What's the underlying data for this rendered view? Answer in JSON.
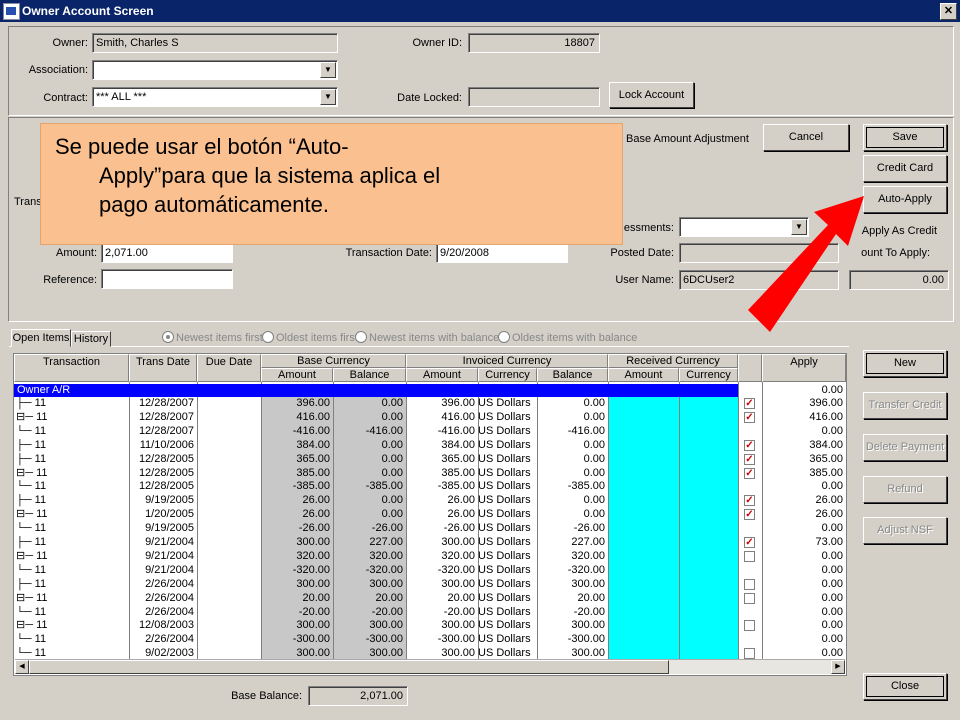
{
  "window": {
    "title": "Owner Account Screen",
    "close_glyph": "✕"
  },
  "owner": {
    "owner_label": "Owner:",
    "owner_value": "Smith, Charles S",
    "owner_id_label": "Owner ID:",
    "owner_id_value": "18807",
    "association_label": "Association:",
    "association_value": "",
    "contract_label": "Contract:",
    "contract_value": "*** ALL ***",
    "date_locked_label": "Date Locked:",
    "date_locked_value": "",
    "lock_button": "Lock Account"
  },
  "transaction": {
    "trans_label_partial": "Trans",
    "base_amount_adjustment": "Base Amount Adjustment",
    "amount_label": "Amount:",
    "amount_value": "2,071.00",
    "reference_label": "Reference:",
    "reference_value": "",
    "transaction_date_label": "Transaction Date:",
    "transaction_date_value": "9/20/2008",
    "assessments_label": "essments:",
    "assessments_value": "",
    "posted_date_label": "Posted Date:",
    "posted_date_value": "",
    "user_name_label": "User Name:",
    "user_name_value": "6DCUser2",
    "apply_as_credit_label": "Apply As Credit",
    "amount_to_apply_label": "ount To Apply:",
    "amount_to_apply_value": "0.00"
  },
  "buttons": {
    "cancel": "Cancel",
    "save": "Save",
    "credit_card": "Credit Card",
    "auto_apply": "Auto-Apply",
    "new": "New",
    "transfer_credit": "Transfer Credit",
    "delete_payment": "Delete Payment",
    "refund": "Refund",
    "adjust_nsf": "Adjust NSF",
    "close": "Close"
  },
  "callout": {
    "line1": "Se puede usar el botón “Auto-",
    "line2": "Apply”para que la sistema aplica el",
    "line3": "pago automáticamente."
  },
  "tabs": {
    "open_items": "Open Items",
    "history": "History"
  },
  "filters": [
    {
      "label": "Newest items first",
      "selected": true
    },
    {
      "label": "Oldest items first",
      "selected": false
    },
    {
      "label": "Newest items with balance",
      "selected": false
    },
    {
      "label": "Oldest items with balance",
      "selected": false
    }
  ],
  "grid": {
    "headers": {
      "transaction": "Transaction",
      "trans_date": "Trans Date",
      "due_date": "Due Date",
      "base_currency": "Base Currency",
      "invoiced_currency": "Invoiced Currency",
      "received_currency": "Received Currency",
      "apply": "Apply",
      "amount": "Amount",
      "balance": "Balance",
      "currency": "Currency"
    },
    "owner_row": {
      "label": "Owner A/R",
      "apply": "0.00"
    },
    "rows": [
      {
        "prefix": "├─",
        "trans": "11",
        "date": "12/28/2007",
        "base_amt": "396.00",
        "base_bal": "0.00",
        "inv_amt": "396.00",
        "cur": "US Dollars",
        "inv_bal": "0.00",
        "check": "checked",
        "apply": "396.00"
      },
      {
        "prefix": "⊟─",
        "trans": "11",
        "date": "12/28/2007",
        "base_amt": "416.00",
        "base_bal": "0.00",
        "inv_amt": "416.00",
        "cur": "US Dollars",
        "inv_bal": "0.00",
        "check": "checked",
        "apply": "416.00"
      },
      {
        "prefix": "   └─",
        "trans": "11",
        "date": "12/28/2007",
        "base_amt": "-416.00",
        "base_bal": "-416.00",
        "inv_amt": "-416.00",
        "cur": "US Dollars",
        "inv_bal": "-416.00",
        "check": "none",
        "apply": "0.00"
      },
      {
        "prefix": "├─",
        "trans": "11",
        "date": "11/10/2006",
        "base_amt": "384.00",
        "base_bal": "0.00",
        "inv_amt": "384.00",
        "cur": "US Dollars",
        "inv_bal": "0.00",
        "check": "checked",
        "apply": "384.00"
      },
      {
        "prefix": "├─",
        "trans": "11",
        "date": "12/28/2005",
        "base_amt": "365.00",
        "base_bal": "0.00",
        "inv_amt": "365.00",
        "cur": "US Dollars",
        "inv_bal": "0.00",
        "check": "checked",
        "apply": "365.00"
      },
      {
        "prefix": "⊟─",
        "trans": "11",
        "date": "12/28/2005",
        "base_amt": "385.00",
        "base_bal": "0.00",
        "inv_amt": "385.00",
        "cur": "US Dollars",
        "inv_bal": "0.00",
        "check": "checked",
        "apply": "385.00"
      },
      {
        "prefix": "   └─",
        "trans": "11",
        "date": "12/28/2005",
        "base_amt": "-385.00",
        "base_bal": "-385.00",
        "inv_amt": "-385.00",
        "cur": "US Dollars",
        "inv_bal": "-385.00",
        "check": "none",
        "apply": "0.00"
      },
      {
        "prefix": "├─",
        "trans": "11",
        "date": "9/19/2005",
        "base_amt": "26.00",
        "base_bal": "0.00",
        "inv_amt": "26.00",
        "cur": "US Dollars",
        "inv_bal": "0.00",
        "check": "checked",
        "apply": "26.00"
      },
      {
        "prefix": "⊟─",
        "trans": "11",
        "date": "1/20/2005",
        "base_amt": "26.00",
        "base_bal": "0.00",
        "inv_amt": "26.00",
        "cur": "US Dollars",
        "inv_bal": "0.00",
        "check": "checked",
        "apply": "26.00"
      },
      {
        "prefix": "   └─",
        "trans": "11",
        "date": "9/19/2005",
        "base_amt": "-26.00",
        "base_bal": "-26.00",
        "inv_amt": "-26.00",
        "cur": "US Dollars",
        "inv_bal": "-26.00",
        "check": "none",
        "apply": "0.00"
      },
      {
        "prefix": "├─",
        "trans": "11",
        "date": "9/21/2004",
        "base_amt": "300.00",
        "base_bal": "227.00",
        "inv_amt": "300.00",
        "cur": "US Dollars",
        "inv_bal": "227.00",
        "check": "checked",
        "apply": "73.00"
      },
      {
        "prefix": "⊟─",
        "trans": "11",
        "date": "9/21/2004",
        "base_amt": "320.00",
        "base_bal": "320.00",
        "inv_amt": "320.00",
        "cur": "US Dollars",
        "inv_bal": "320.00",
        "check": "empty",
        "apply": "0.00"
      },
      {
        "prefix": "   └─",
        "trans": "11",
        "date": "9/21/2004",
        "base_amt": "-320.00",
        "base_bal": "-320.00",
        "inv_amt": "-320.00",
        "cur": "US Dollars",
        "inv_bal": "-320.00",
        "check": "none",
        "apply": "0.00"
      },
      {
        "prefix": "├─",
        "trans": "11",
        "date": "2/26/2004",
        "base_amt": "300.00",
        "base_bal": "300.00",
        "inv_amt": "300.00",
        "cur": "US Dollars",
        "inv_bal": "300.00",
        "check": "empty",
        "apply": "0.00"
      },
      {
        "prefix": "⊟─",
        "trans": "11",
        "date": "2/26/2004",
        "base_amt": "20.00",
        "base_bal": "20.00",
        "inv_amt": "20.00",
        "cur": "US Dollars",
        "inv_bal": "20.00",
        "check": "empty",
        "apply": "0.00"
      },
      {
        "prefix": "   └─",
        "trans": "11",
        "date": "2/26/2004",
        "base_amt": "-20.00",
        "base_bal": "-20.00",
        "inv_amt": "-20.00",
        "cur": "US Dollars",
        "inv_bal": "-20.00",
        "check": "none",
        "apply": "0.00"
      },
      {
        "prefix": "⊟─",
        "trans": "11",
        "date": "12/08/2003",
        "base_amt": "300.00",
        "base_bal": "300.00",
        "inv_amt": "300.00",
        "cur": "US Dollars",
        "inv_bal": "300.00",
        "check": "empty",
        "apply": "0.00"
      },
      {
        "prefix": "   └─",
        "trans": "11",
        "date": "2/26/2004",
        "base_amt": "-300.00",
        "base_bal": "-300.00",
        "inv_amt": "-300.00",
        "cur": "US Dollars",
        "inv_bal": "-300.00",
        "check": "none",
        "apply": "0.00"
      },
      {
        "prefix": "└─",
        "trans": "11",
        "date": "9/02/2003",
        "base_amt": "300.00",
        "base_bal": "300.00",
        "inv_amt": "300.00",
        "cur": "US Dollars",
        "inv_bal": "300.00",
        "check": "empty",
        "apply": "0.00"
      }
    ]
  },
  "footer": {
    "base_balance_label": "Base Balance:",
    "base_balance_value": "2,071.00"
  },
  "colors": {
    "title_bar": "#0a246a",
    "selected_row": "#0000ff",
    "received_cols": "#00ffff",
    "callout": "#fac090",
    "arrow": "#ff0000"
  },
  "icons": [
    "app-icon",
    "close-icon",
    "dropdown-arrow-icon",
    "checkbox-icon",
    "red-arrow"
  ]
}
